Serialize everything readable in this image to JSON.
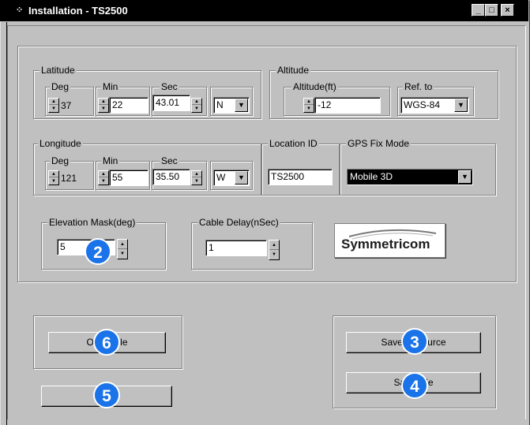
{
  "window": {
    "title": "Installation - TS2500",
    "controls": [
      "_",
      "□",
      "×"
    ]
  },
  "latitude": {
    "label": "Latitude",
    "deg": {
      "label": "Deg",
      "value": "37"
    },
    "min": {
      "label": "Min",
      "value": "22"
    },
    "sec": {
      "label": "Sec",
      "value": "43.01"
    },
    "dir": "N"
  },
  "altitude": {
    "label": "Altitude",
    "alt": {
      "label": "Altitude(ft)",
      "value": "-12"
    },
    "ref": {
      "label": "Ref. to",
      "value": "WGS-84"
    }
  },
  "longitude": {
    "label": "Longitude",
    "deg": {
      "label": "Deg",
      "value": "121"
    },
    "min": {
      "label": "Min",
      "value": "55"
    },
    "sec": {
      "label": "Sec",
      "value": "35.50"
    },
    "dir": "W"
  },
  "location": {
    "label": "Location ID",
    "value": "TS2500"
  },
  "gps": {
    "label": "GPS Fix Mode",
    "value": "Mobile 3D"
  },
  "elevation": {
    "label": "Elevation Mask(deg)",
    "value": "5"
  },
  "cable": {
    "label": "Cable Delay(nSec)",
    "value": "1"
  },
  "logo": {
    "text": "Symmetricom"
  },
  "buttons": {
    "open_file": "Open File",
    "blank": "",
    "save_source": "Save to Source",
    "save_file": "Save File"
  },
  "badges": {
    "b2": "2",
    "b3": "3",
    "b4": "4",
    "b5": "5",
    "b6": "6"
  },
  "colors": {
    "titlebar": "#000000",
    "face": "#c0c0c0",
    "badge": "#1a73e8",
    "selection": "#000000"
  }
}
